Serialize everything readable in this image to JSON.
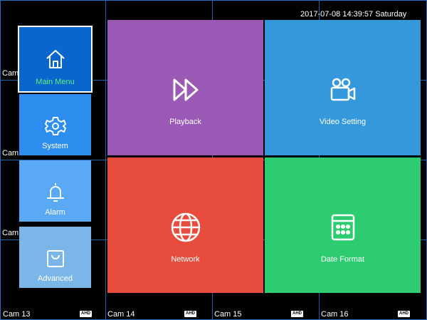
{
  "status": {
    "datetime": "2017-07-08 14:39:57  Saturday"
  },
  "cameras": {
    "partial": [
      "Cam",
      "Cam",
      "Cam"
    ],
    "bottom": [
      "Cam 13",
      "Cam 14",
      "Cam 15",
      "Cam 16"
    ],
    "badge": "AHD"
  },
  "side_menu": [
    {
      "label": "Main Menu",
      "icon": "home-icon",
      "color": "#0a66cc",
      "selected": true
    },
    {
      "label": "System",
      "icon": "gear-icon",
      "color": "#2d8ef0",
      "selected": false
    },
    {
      "label": "Alarm",
      "icon": "bell-icon",
      "color": "#5aa9f5",
      "selected": false
    },
    {
      "label": "Advanced",
      "icon": "bag-icon",
      "color": "#7ab6e8",
      "selected": false
    }
  ],
  "tiles": [
    {
      "label": "Playback",
      "icon": "fast-forward-icon",
      "color": "#9b59b6"
    },
    {
      "label": "Video Setting",
      "icon": "video-camera-icon",
      "color": "#3498db"
    },
    {
      "label": "Network",
      "icon": "globe-icon",
      "color": "#e74c3c"
    },
    {
      "label": "Date Format",
      "icon": "calendar-grid-icon",
      "color": "#2ecc71"
    }
  ]
}
